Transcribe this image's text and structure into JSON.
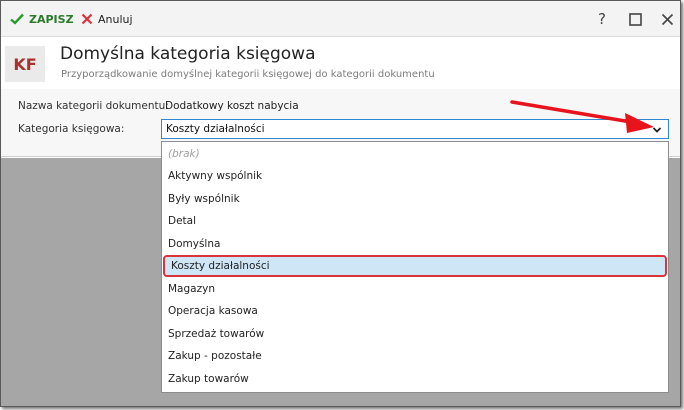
{
  "toolbar": {
    "save_label": "ZAPISZ",
    "cancel_label": "Anuluj",
    "help_glyph": "?"
  },
  "header": {
    "badge": "KF",
    "title": "Domyślna kategoria księgowa",
    "subtitle": "Przyporządkowanie domyślnej kategorii księgowej do kategorii dokumentu"
  },
  "form": {
    "document_category_label": "Nazwa kategorii dokumentu:",
    "document_category_value": "Dodatkowy koszt nabycia",
    "accounting_category_label": "Kategoria księgowa:",
    "accounting_category_value": "Koszty działalności"
  },
  "dropdown": {
    "options": [
      "(brak)",
      "Aktywny wspólnik",
      "Były wspólnik",
      "Detal",
      "Domyślna",
      "Koszty działalności",
      "Magazyn",
      "Operacja kasowa",
      "Sprzedaż towarów",
      "Zakup - pozostałe",
      "Zakup towarów"
    ],
    "selected": "Koszty działalności"
  },
  "colors": {
    "accent_blue": "#2f88d4",
    "save_green": "#2b7a2b",
    "cancel_red": "#d9343b",
    "highlight": "#cfe6f7",
    "annotation_red": "#e8141c",
    "badge_red": "#a8312d"
  },
  "icons": {
    "save": "check-icon",
    "cancel": "x-icon",
    "maximize": "square-icon",
    "close": "close-icon",
    "dropdown": "chevron-down-icon",
    "annotation": "red-arrow-icon"
  }
}
